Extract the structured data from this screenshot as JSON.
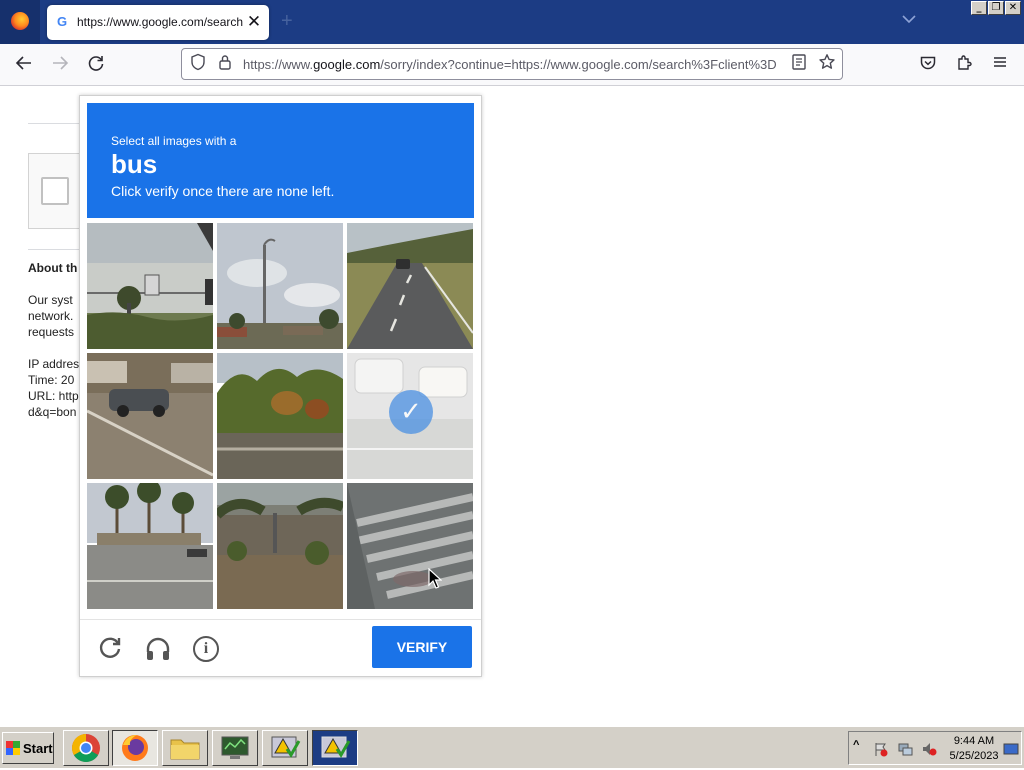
{
  "browser": {
    "tab_title": "https://www.google.com/search?c",
    "tab_favicon": "G",
    "url_prefix": "https://www.",
    "url_domain": "google.com",
    "url_rest": "/sorry/index?continue=https://www.google.com/search%3Fclient%3D"
  },
  "page": {
    "about_heading": "About th",
    "body_lines": [
      "Our syst",
      "network.",
      "requests"
    ],
    "info_lines": [
      "IP addres",
      "Time: 20",
      "URL: http",
      "d&q=bon"
    ]
  },
  "captcha": {
    "line1": "Select all images with a",
    "word": "bus",
    "line3": "Click verify once there are none left.",
    "tiles": [
      {
        "desc": "traffic-light-intersection",
        "selected": false
      },
      {
        "desc": "street-lamp-sky",
        "selected": false
      },
      {
        "desc": "highway-car",
        "selected": false
      },
      {
        "desc": "parked-car-street",
        "selected": false
      },
      {
        "desc": "trees-roadside",
        "selected": false
      },
      {
        "desc": "parked-vehicles",
        "selected": true
      },
      {
        "desc": "palm-tree-road",
        "selected": false
      },
      {
        "desc": "overpass-construction",
        "selected": false
      },
      {
        "desc": "crosswalk",
        "selected": false
      }
    ],
    "verify_label": "VERIFY",
    "checkmark": "✓"
  },
  "taskbar": {
    "start_label": "Start",
    "time": "9:44 AM",
    "date": "5/25/2023"
  },
  "colors": {
    "captcha_blue": "#1a73e8",
    "titlebar": "#1c3c84"
  }
}
